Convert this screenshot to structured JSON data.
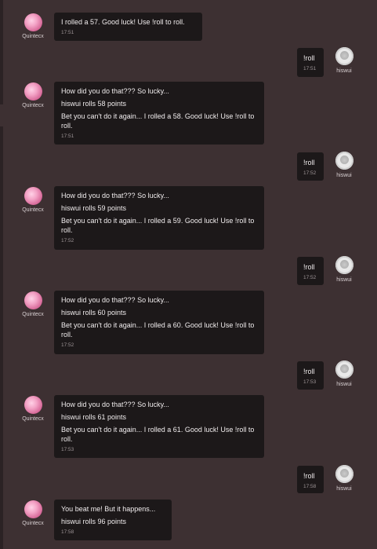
{
  "conversation": [
    {
      "side": "bot",
      "name": "Quintecx",
      "lines": [
        "I rolled a 57. Good luck! Use !roll to roll."
      ],
      "time": "17:51"
    },
    {
      "side": "user",
      "name": "hiswui",
      "lines": [
        "!roll"
      ],
      "time": "17:51"
    },
    {
      "side": "bot",
      "name": "Quintecx",
      "lines": [
        "How did you do that??? So lucky...",
        "hiswui rolls 58 points",
        "Bet you can't do it again... I rolled a 58. Good luck! Use !roll to roll."
      ],
      "time": "17:51"
    },
    {
      "side": "user",
      "name": "hiswui",
      "lines": [
        "!roll"
      ],
      "time": "17:52"
    },
    {
      "side": "bot",
      "name": "Quintecx",
      "lines": [
        "How did you do that??? So lucky...",
        "hiswui rolls 59 points",
        "Bet you can't do it again... I rolled a 59. Good luck! Use !roll to roll."
      ],
      "time": "17:52"
    },
    {
      "side": "user",
      "name": "hiswui",
      "lines": [
        "!roll"
      ],
      "time": "17:52"
    },
    {
      "side": "bot",
      "name": "Quintecx",
      "lines": [
        "How did you do that??? So lucky...",
        "hiswui rolls 60 points",
        "Bet you can't do it again... I rolled a 60. Good luck! Use !roll to roll."
      ],
      "time": "17:52"
    },
    {
      "side": "user",
      "name": "hiswui",
      "lines": [
        "!roll"
      ],
      "time": "17:53"
    },
    {
      "side": "bot",
      "name": "Quintecx",
      "lines": [
        "How did you do that??? So lucky...",
        "hiswui rolls 61 points",
        "Bet you can't do it again... I rolled a 61. Good luck! Use !roll to roll."
      ],
      "time": "17:53"
    },
    {
      "side": "user",
      "name": "hiswui",
      "lines": [
        "!roll"
      ],
      "time": "17:58"
    },
    {
      "side": "bot",
      "name": "Quintecx",
      "lines": [
        "You beat me! But it happens...",
        "hiswui rolls 96 points"
      ],
      "time": "17:58"
    }
  ]
}
